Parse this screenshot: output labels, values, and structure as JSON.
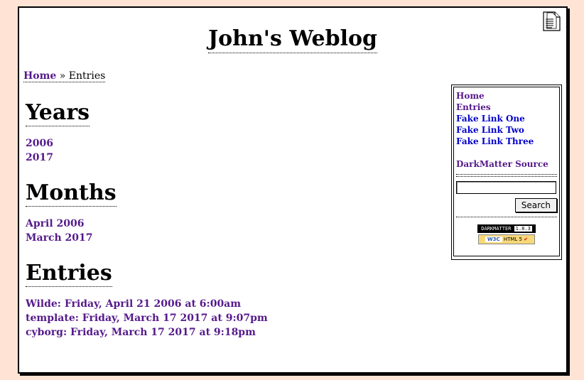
{
  "header": {
    "title": "John's Weblog",
    "icon": "document-icon"
  },
  "breadcrumb": {
    "home": "Home",
    "separator": "»",
    "current": "Entries"
  },
  "sections": {
    "years_title": "Years",
    "years": [
      "2006",
      "2017"
    ],
    "months_title": "Months",
    "months": [
      "April 2006",
      "March 2017"
    ],
    "entries_title": "Entries",
    "entries": [
      "Wilde: Friday, April 21 2006 at 6:00am",
      "template: Friday, March 17 2017 at 9:07pm",
      "cyborg: Friday, March 17 2017 at 9:18pm"
    ]
  },
  "sidebar": {
    "links": [
      "Home",
      "Entries",
      "Fake Link One",
      "Fake Link Two",
      "Fake Link Three"
    ],
    "source_link": "DarkMatter Source",
    "search_value": "",
    "search_button": "Search",
    "badge_darkmatter": "DARKMATTER",
    "badge_darkmatter_ver": "1.8.3",
    "badge_w3c": "W3C",
    "badge_html5": "HTML 5"
  },
  "colors": {
    "background": "#ffe4d6",
    "visited_link": "#551a8b",
    "link": "#0000cc"
  }
}
